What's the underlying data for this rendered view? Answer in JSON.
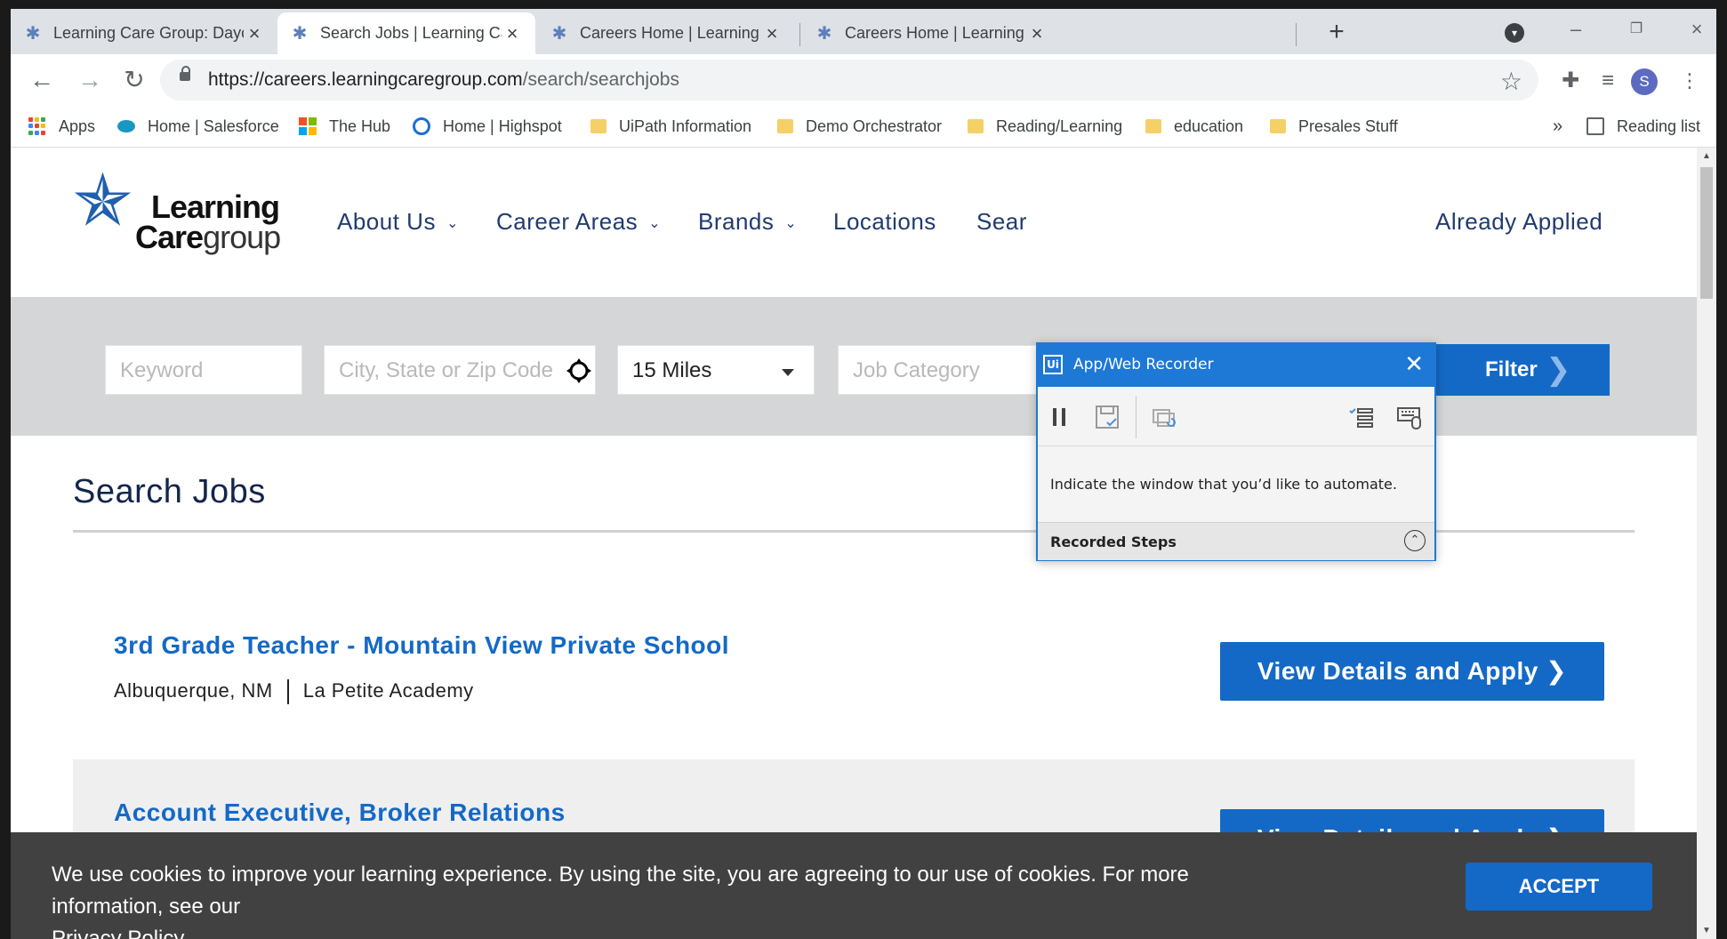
{
  "tabs": [
    {
      "title": "Learning Care Group: Daycare &",
      "active": false
    },
    {
      "title": "Search Jobs | Learning Care Grou",
      "active": true
    },
    {
      "title": "Careers Home | Learning Care Gr",
      "active": false
    },
    {
      "title": "Careers Home | Learning Care Gr",
      "active": false
    }
  ],
  "browser": {
    "url_host": "https://careers.learningcaregroup.com",
    "url_path": "/search/searchjobs",
    "profile_initial": "S",
    "new_tab": "+",
    "overflow": "»"
  },
  "bookmarks": [
    {
      "label": "Apps",
      "icon": "apps-grid-icon"
    },
    {
      "label": "Home | Salesforce",
      "icon": "salesforce-cloud-icon"
    },
    {
      "label": "The Hub",
      "icon": "windows-logo-icon"
    },
    {
      "label": "Home | Highspot",
      "icon": "highspot-icon"
    },
    {
      "label": "UiPath Information",
      "icon": "folder-icon"
    },
    {
      "label": "Demo Orchestrator",
      "icon": "folder-icon"
    },
    {
      "label": "Reading/Learning",
      "icon": "folder-icon"
    },
    {
      "label": "education",
      "icon": "folder-icon"
    },
    {
      "label": "Presales Stuff",
      "icon": "folder-icon"
    }
  ],
  "reading_list": "Reading list",
  "site": {
    "logo_line1": "Learning",
    "logo_line2a": "Care",
    "logo_line2b": "group",
    "nav": [
      {
        "label": "About Us",
        "dropdown": true
      },
      {
        "label": "Career Areas",
        "dropdown": true
      },
      {
        "label": "Brands",
        "dropdown": true
      },
      {
        "label": "Locations",
        "dropdown": false
      },
      {
        "label": "Sear",
        "dropdown": false
      },
      {
        "label": "Already Applied",
        "dropdown": false
      }
    ],
    "filters": {
      "keyword_placeholder": "Keyword",
      "location_placeholder": "City, State or Zip Code",
      "distance_value": "15 Miles",
      "category_placeholder": "Job Category",
      "filter_label": "Filter"
    },
    "heading": "Search Jobs",
    "jobs": [
      {
        "title": "3rd Grade Teacher - Mountain View Private School",
        "location": "Albuquerque, NM",
        "brand": "La Petite Academy",
        "button": "View Details and Apply ❯"
      },
      {
        "title": "Account Executive, Broker Relations",
        "location": "",
        "brand": "",
        "button": "View Details and Apply ❯"
      }
    ],
    "cookie": {
      "message": "We use cookies to improve your learning experience. By using the site, you are agreeing to our use of cookies. For more information, see our",
      "link": "Privacy Policy",
      "accept": "ACCEPT"
    }
  },
  "recorder": {
    "title": "App/Web Recorder",
    "logo": "Ui",
    "message": "Indicate the window that you’d like to automate.",
    "steps_label": "Recorded Steps"
  },
  "colors": {
    "brand_blue": "#1469c6",
    "nav_navy": "#1f3b70",
    "recorder_blue": "#1e78d6"
  }
}
